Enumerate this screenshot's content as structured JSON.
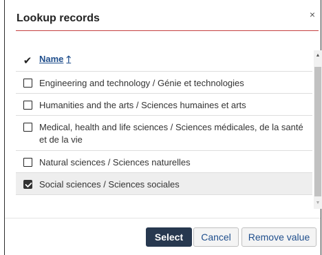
{
  "dialog": {
    "title": "Lookup records",
    "close_glyph": "×"
  },
  "grid": {
    "header": {
      "check_glyph": "✔",
      "name_label": "Name",
      "sort_glyph": "🡑"
    },
    "rows": [
      {
        "label": "Engineering and technology / Génie et technologies",
        "checked": false
      },
      {
        "label": "Humanities and the arts / Sciences humaines et arts",
        "checked": false
      },
      {
        "label": "Medical, health and life sciences / Sciences médicales, de la santé et de la vie",
        "checked": false
      },
      {
        "label": "Natural sciences / Sciences naturelles",
        "checked": false
      },
      {
        "label": "Social sciences / Sciences sociales",
        "checked": true
      }
    ]
  },
  "scrollbar": {
    "up_glyph": "▲",
    "down_glyph": "▼"
  },
  "buttons": {
    "select": "Select",
    "cancel": "Cancel",
    "remove": "Remove value"
  },
  "colors": {
    "accent": "#c43f3f",
    "primary_button": "#27384f",
    "link": "#1f4e8c"
  }
}
